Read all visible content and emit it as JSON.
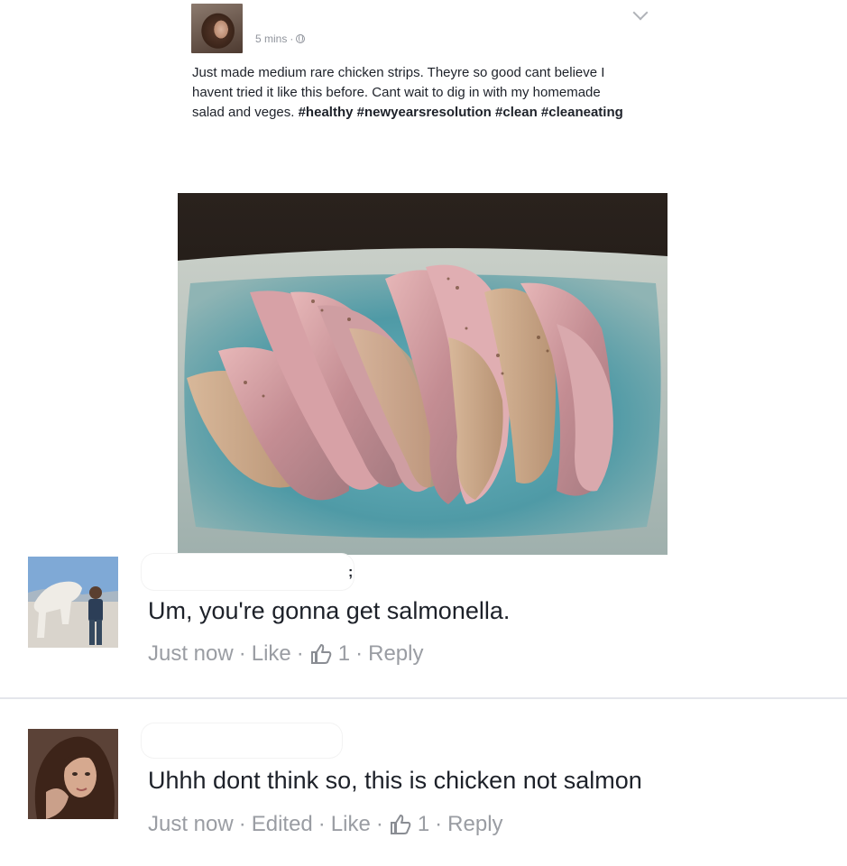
{
  "post": {
    "timestamp": "5 mins",
    "meta_separator": "·",
    "text_plain": "Just made medium rare chicken strips. Theyre so good cant believe I havent tried it like this before. Cant wait to dig in with my homemade salad and veges.",
    "hashtags": [
      "#healthy",
      "#newyearsresolution",
      "#clean",
      "#cleaneating"
    ],
    "icons": {
      "privacy": "globe-icon",
      "options": "chevron-down-icon"
    }
  },
  "comments": [
    {
      "text": "Um, you're gonna get salmonella.",
      "time": "Just now",
      "like_label": "Like",
      "like_count": "1",
      "reply_label": "Reply"
    },
    {
      "text": "Uhhh dont think so, this is chicken not salmon",
      "time": "Just now",
      "edited_label": "Edited",
      "like_label": "Like",
      "like_count": "1",
      "reply_label": "Reply"
    }
  ],
  "stray_mark": ";",
  "colors": {
    "text": "#1d2129",
    "meta": "#90949c",
    "action": "#9a9da3",
    "divider": "#e4e6eb",
    "plate": "#4f9aa6"
  }
}
